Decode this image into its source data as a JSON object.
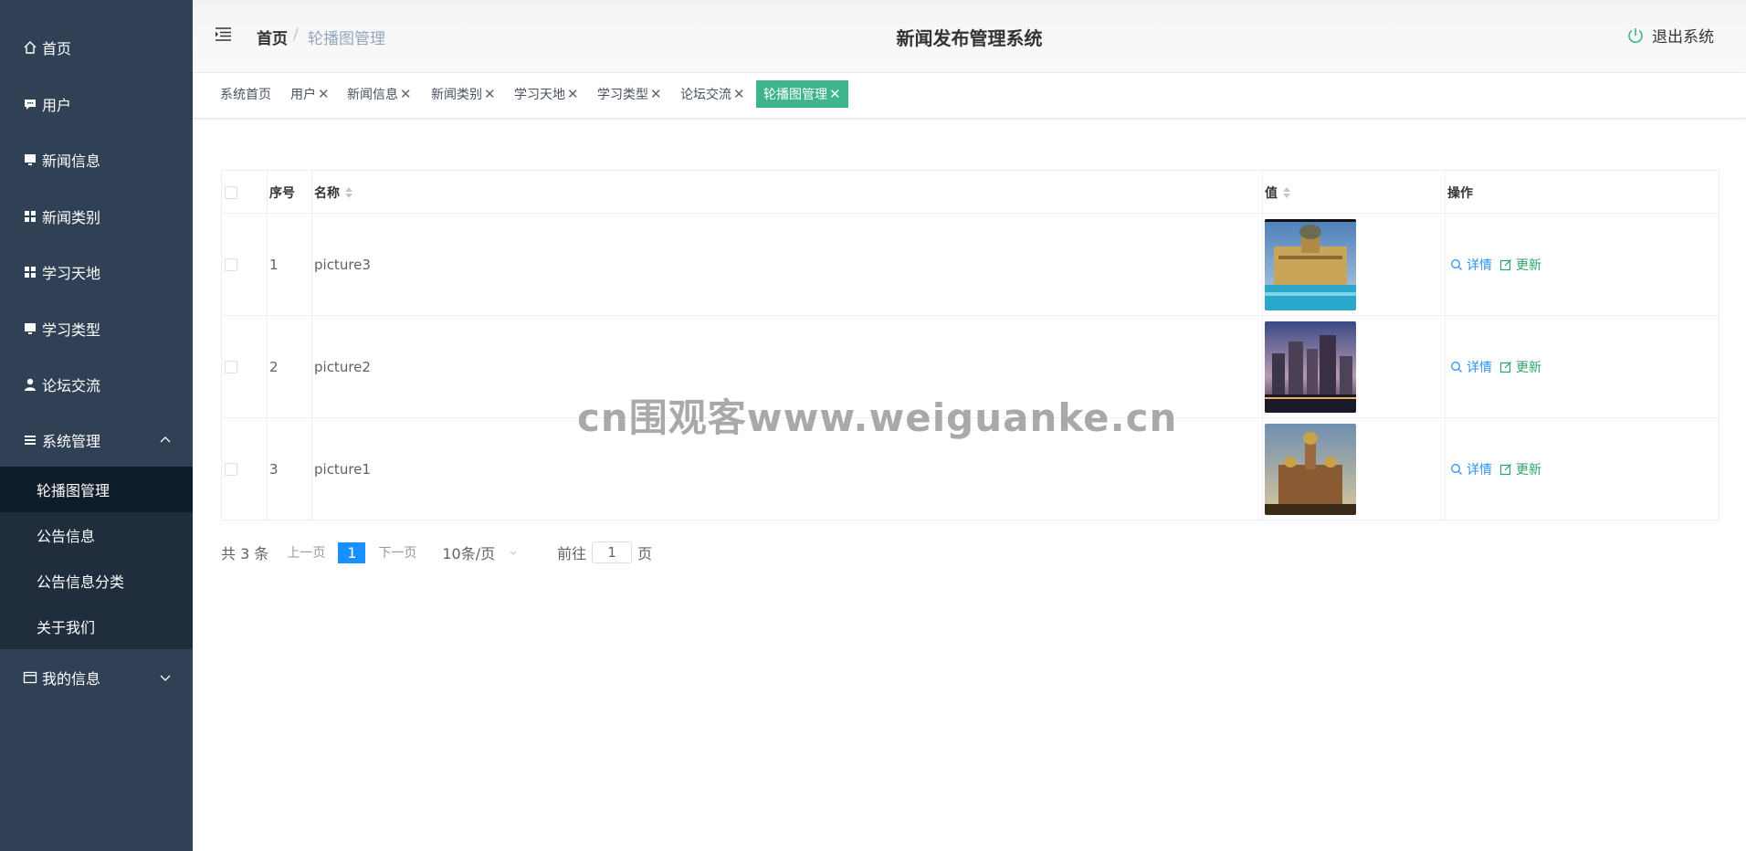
{
  "sidebar": {
    "items": [
      {
        "label": "首页",
        "icon": "home-icon"
      },
      {
        "label": "用户",
        "icon": "chat-icon"
      },
      {
        "label": "新闻信息",
        "icon": "monitor-icon"
      },
      {
        "label": "新闻类别",
        "icon": "grid-icon"
      },
      {
        "label": "学习天地",
        "icon": "grid-icon"
      },
      {
        "label": "学习类型",
        "icon": "monitor-icon"
      },
      {
        "label": "论坛交流",
        "icon": "user-icon"
      },
      {
        "label": "系统管理",
        "icon": "list-icon"
      },
      {
        "label": "我的信息",
        "icon": "card-icon"
      }
    ],
    "submenu": [
      "轮播图管理",
      "公告信息",
      "公告信息分类",
      "关于我们"
    ]
  },
  "header": {
    "breadcrumb_home": "首页",
    "breadcrumb_sep": "/",
    "breadcrumb_current": "轮播图管理",
    "title": "新闻发布管理系统",
    "logout": "退出系统"
  },
  "tags": [
    {
      "label": "系统首页",
      "closable": false
    },
    {
      "label": "用户",
      "closable": true
    },
    {
      "label": "新闻信息",
      "closable": true
    },
    {
      "label": "新闻类别",
      "closable": true
    },
    {
      "label": "学习天地",
      "closable": true
    },
    {
      "label": "学习类型",
      "closable": true
    },
    {
      "label": "论坛交流",
      "closable": true
    },
    {
      "label": "轮播图管理",
      "closable": true
    }
  ],
  "table": {
    "headers": {
      "index": "序号",
      "name": "名称",
      "value": "值",
      "actions": "操作"
    },
    "rows": [
      {
        "index": "1",
        "name": "picture3",
        "image": "palace-photo"
      },
      {
        "index": "2",
        "name": "picture2",
        "image": "city-night-photo"
      },
      {
        "index": "3",
        "name": "picture1",
        "image": "cathedral-photo"
      }
    ],
    "detail_label": "详情",
    "update_label": "更新"
  },
  "pagination": {
    "total_text": "共 3 条",
    "prev": "上一页",
    "current_page": "1",
    "next": "下一页",
    "page_size": "10条/页",
    "goto_label": "前往",
    "goto_value": "1",
    "page_unit": "页"
  },
  "watermark": "cn围观客www.weiguanke.cn",
  "colors": {
    "sidebar_bg": "#304156",
    "accent": "#3db48a",
    "detail": "#2e93f5",
    "update": "#2aa56c",
    "page_active": "#1890ff"
  }
}
